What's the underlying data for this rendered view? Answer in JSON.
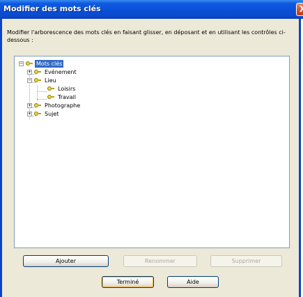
{
  "window": {
    "title": "Modifier des mots clés",
    "close_glyph": "X"
  },
  "description": "Modifier l'arborescence des mots clés en faisant glisser, en déposant et en utilisant les contrôles ci-dessous :",
  "tree": {
    "root": {
      "label": "Mots clés",
      "expander": "−",
      "selected": true
    },
    "items": [
      {
        "label": "Evénement",
        "expander": "+"
      },
      {
        "label": "Lieu",
        "expander": "−"
      },
      {
        "label": "Loisirs"
      },
      {
        "label": "Travail"
      },
      {
        "label": "Photographe",
        "expander": "+"
      },
      {
        "label": "Sujet",
        "expander": "+"
      }
    ]
  },
  "buttons": {
    "add": "Ajouter",
    "rename": "Renommer",
    "delete": "Supprimer",
    "done": "Terminé",
    "help": "Aide"
  }
}
